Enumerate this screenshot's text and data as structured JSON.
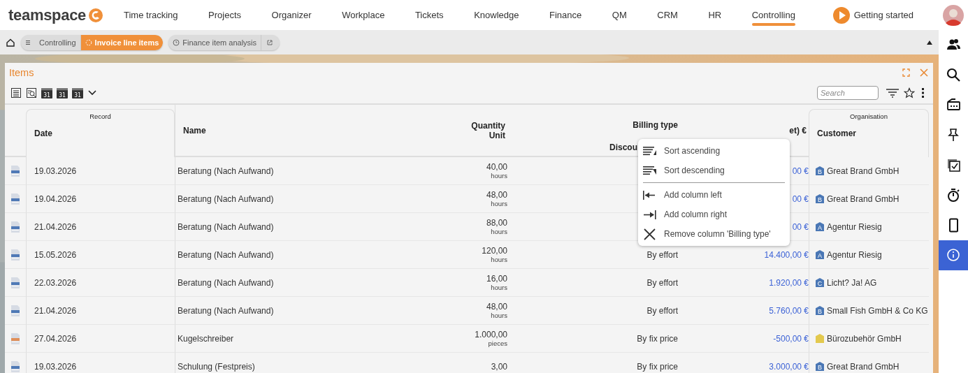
{
  "nav": {
    "logo": "teamspace",
    "items": [
      {
        "label": "Time tracking",
        "selected": false
      },
      {
        "label": "Projects",
        "selected": false
      },
      {
        "label": "Organizer",
        "selected": false
      },
      {
        "label": "Workplace",
        "selected": false
      },
      {
        "label": "Tickets",
        "selected": false
      },
      {
        "label": "Knowledge",
        "selected": false
      },
      {
        "label": "Finance",
        "selected": false
      },
      {
        "label": "QM",
        "selected": false
      },
      {
        "label": "CRM",
        "selected": false
      },
      {
        "label": "HR",
        "selected": false
      },
      {
        "label": "Controlling",
        "selected": true
      }
    ],
    "getting_started": "Getting started"
  },
  "breadcrumb": {
    "crumbs": [
      {
        "label": "Controlling",
        "selected": false
      },
      {
        "label": "Invoice line items",
        "selected": true
      }
    ],
    "tab": "Finance item analysis"
  },
  "panel": {
    "title": "Items",
    "toolbar": [
      {
        "kind": "list"
      },
      {
        "kind": "preview"
      },
      {
        "kind": "calendar",
        "label": "31"
      },
      {
        "kind": "calendar",
        "label": "31"
      },
      {
        "kind": "calendar",
        "label": "31"
      },
      {
        "kind": "expand"
      }
    ],
    "search": {
      "placeholder": "Search"
    }
  },
  "table": {
    "columns": [
      {
        "group": "Record",
        "lines": [
          "Date"
        ]
      },
      {
        "lines": [
          "Name"
        ]
      },
      {
        "lines": [
          "Quantity",
          "Unit"
        ]
      },
      {
        "lines": [
          "Billing type",
          "Discou"
        ]
      },
      {
        "lines": [
          "et) €"
        ]
      },
      {
        "group": "Organisation",
        "lines": [
          "Customer"
        ]
      }
    ],
    "rows": [
      {
        "color": "#4f79b6",
        "date": "19.03.2026",
        "name": "Beratung (Nach Aufwand)",
        "quantity": "40,00",
        "unit": "hours",
        "amount": "00 €",
        "customer": {
          "badge": "B",
          "color": "#4a77b5",
          "name": "Great Brand GmbH"
        }
      },
      {
        "color": "#4f79b6",
        "date": "19.04.2026",
        "name": "Beratung (Nach Aufwand)",
        "quantity": "48,00",
        "unit": "hours",
        "amount": "00 €",
        "customer": {
          "badge": "B",
          "color": "#4a77b5",
          "name": "Great Brand GmbH"
        }
      },
      {
        "color": "#4f79b6",
        "date": "21.04.2026",
        "name": "Beratung (Nach Aufwand)",
        "quantity": "88,00",
        "unit": "hours",
        "amount": "00 €",
        "customer": {
          "badge": "A",
          "color": "#4a77b5",
          "name": "Agentur Riesig"
        }
      },
      {
        "color": "#4f79b6",
        "date": "15.05.2026",
        "name": "Beratung (Nach Aufwand)",
        "quantity": "120,00",
        "unit": "hours",
        "billing_type": "By effort",
        "amount": "14.400,00 €",
        "customer": {
          "badge": "A",
          "color": "#4a77b5",
          "name": "Agentur Riesig"
        }
      },
      {
        "color": "#4f79b6",
        "date": "22.03.2026",
        "name": "Beratung (Nach Aufwand)",
        "quantity": "16,00",
        "unit": "hours",
        "billing_type": "By effort",
        "amount": "1.920,00 €",
        "customer": {
          "badge": "C",
          "color": "#4a77b5",
          "name": "Licht? Ja! AG"
        }
      },
      {
        "color": "#4f79b6",
        "date": "21.04.2026",
        "name": "Beratung (Nach Aufwand)",
        "quantity": "48,00",
        "unit": "hours",
        "billing_type": "By effort",
        "amount": "5.760,00 €",
        "customer": {
          "badge": "B",
          "color": "#4a77b5",
          "name": "Small Fish GmbH & Co KG"
        }
      },
      {
        "color": "#e0905a",
        "date": "27.04.2026",
        "name": "Kugelschreiber",
        "quantity": "1.000,00",
        "unit": "pieces",
        "billing_type": "By fix price",
        "amount": "-500,00 €",
        "customer": {
          "color": "#e3c94e",
          "name": "Bürozubehör GmbH"
        }
      },
      {
        "color": "#4f79b6",
        "date": "19.03.2026",
        "name": "Schulung (Festpreis)",
        "quantity": "3,00",
        "billing_type": "By fix price",
        "amount": "3.000,00 €",
        "customer": {
          "badge": "B",
          "color": "#4a77b5",
          "name": "Great Brand GmbH"
        }
      }
    ]
  },
  "context_menu": {
    "items": [
      {
        "kind": "item",
        "label": "Sort ascending"
      },
      {
        "kind": "item",
        "label": "Sort descending"
      },
      {
        "kind": "separator"
      },
      {
        "kind": "item",
        "label": "Add column left"
      },
      {
        "kind": "item",
        "label": "Add column right"
      },
      {
        "kind": "item",
        "label": "Remove column 'Billing type'"
      }
    ]
  },
  "sidebar": {
    "items": [
      {
        "selected": false
      },
      {
        "selected": false
      },
      {
        "selected": false
      },
      {
        "selected": false
      },
      {
        "selected": false
      },
      {
        "selected": false
      },
      {
        "selected": false
      },
      {
        "selected": true
      }
    ]
  }
}
